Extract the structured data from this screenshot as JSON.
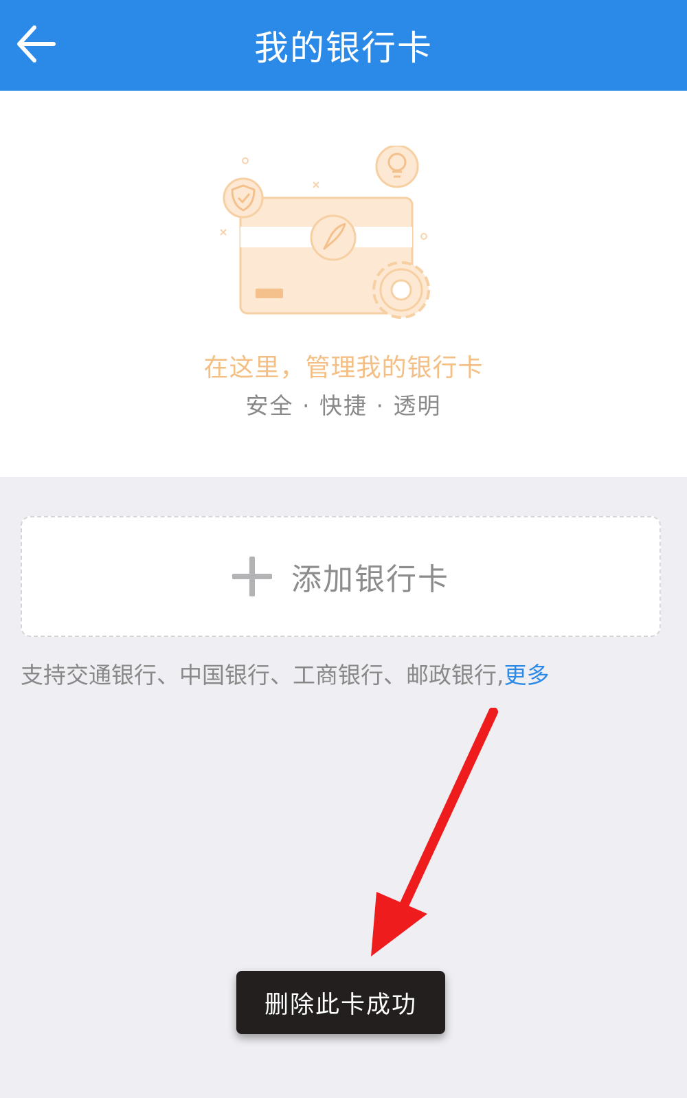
{
  "header": {
    "title": "我的银行卡",
    "back_icon": "arrow-left-icon",
    "background_color": "#2b8ae8"
  },
  "hero": {
    "illustration_icon": "bank-card-illustration",
    "headline": "在这里，管理我的银行卡",
    "tagline": "安全 · 快捷 · 透明",
    "accent_color": "#f3bf84"
  },
  "add_card": {
    "icon": "plus-icon",
    "label": "添加银行卡"
  },
  "support": {
    "text": "支持交通银行、中国银行、工商银行、邮政银行,",
    "more_label": "更多",
    "link_color": "#2b8ae8"
  },
  "annotation": {
    "icon": "red-arrow-icon",
    "color": "#ee1c1c"
  },
  "toast": {
    "message": "删除此卡成功"
  }
}
